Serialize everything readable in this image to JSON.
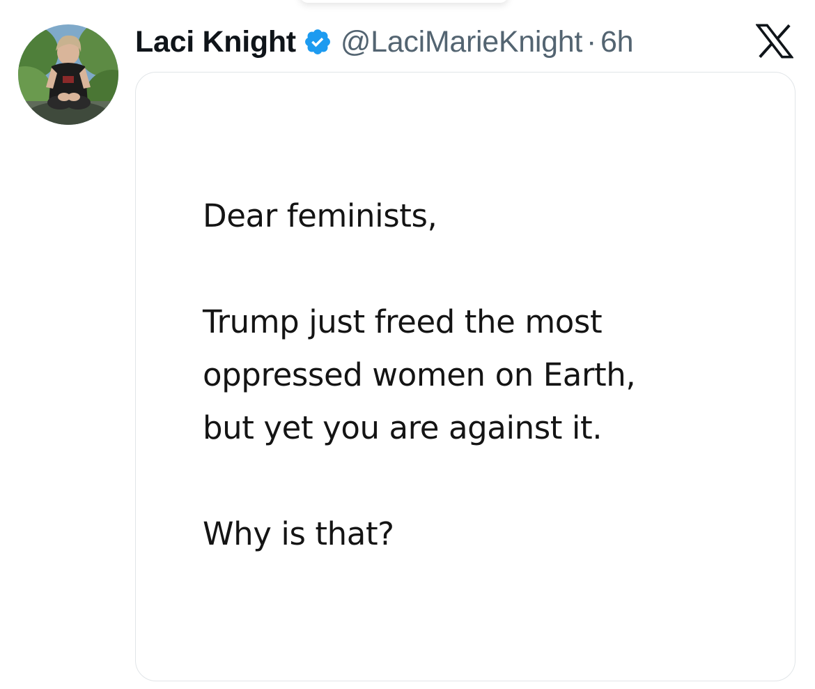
{
  "tweet": {
    "author": {
      "display_name": "Laci Knight",
      "handle": "@LaciMarieKnight",
      "verified": true,
      "avatar_icon": "profile-photo"
    },
    "separator": "·",
    "timestamp": "6h",
    "platform_logo": "x-logo-icon",
    "image_text": {
      "greeting": "Dear feminists,",
      "body_line_1": "Trump just freed the most",
      "body_line_2": "oppressed women on Earth,",
      "body_line_3": "but yet you are against it.",
      "question": "Why is that?"
    }
  },
  "colors": {
    "name": "#0f1419",
    "secondary": "#536471",
    "verified_badge": "#1d9bf0",
    "card_border": "#e1e5e8"
  }
}
